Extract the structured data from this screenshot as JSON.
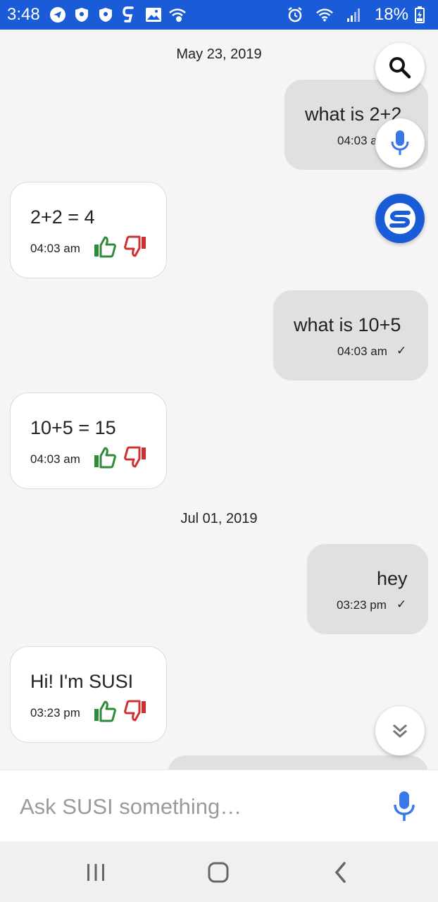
{
  "status_bar": {
    "time": "3:48",
    "battery": "18%",
    "left_icons": [
      "telegram-icon",
      "shield-icon",
      "shield-icon",
      "gaana-icon",
      "image-icon",
      "wifi-hotspot-icon"
    ],
    "right_icons": [
      "alarm-icon",
      "wifi-icon",
      "signal-icon",
      "battery-charging-icon"
    ]
  },
  "chat": {
    "dates": [
      "May 23, 2019",
      "Jul 01, 2019"
    ],
    "messages": [
      {
        "from": "user",
        "text": "what is 2+2",
        "time": "04:03 am"
      },
      {
        "from": "bot",
        "text": "2+2 = 4",
        "time": "04:03 am"
      },
      {
        "from": "user",
        "text": "what is 10+5",
        "time": "04:03 am"
      },
      {
        "from": "bot",
        "text": "10+5 = 15",
        "time": "04:03 am"
      },
      {
        "from": "user",
        "text": "hey",
        "time": "03:23 pm"
      },
      {
        "from": "bot",
        "text": "Hi! I'm SUSI",
        "time": "03:23 pm"
      }
    ],
    "check_mark": "✓"
  },
  "input": {
    "placeholder": "Ask SUSI something…",
    "value": ""
  },
  "colors": {
    "brand_blue": "#1a5bd8",
    "thumb_up": "#2e8b3a",
    "thumb_down": "#d03030",
    "mic_blue": "#3b78e7"
  }
}
